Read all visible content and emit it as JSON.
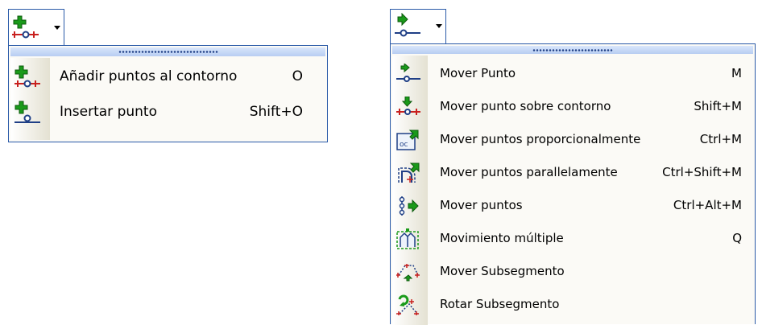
{
  "menu_left": {
    "button_icon": "add-points-icon",
    "items": [
      {
        "label": "Añadir puntos al contorno",
        "shortcut": "O",
        "icon": "add-points-contour-icon"
      },
      {
        "label": "Insertar punto",
        "shortcut": "Shift+O",
        "icon": "insert-point-icon"
      }
    ]
  },
  "menu_right": {
    "button_icon": "move-point-icon",
    "items": [
      {
        "label": "Mover Punto",
        "shortcut": "M",
        "icon": "move-point-icon"
      },
      {
        "label": "Mover punto sobre contorno",
        "shortcut": "Shift+M",
        "icon": "move-point-on-contour-icon"
      },
      {
        "label": "Mover puntos proporcionalmente",
        "shortcut": "Ctrl+M",
        "icon": "move-points-proportionally-icon"
      },
      {
        "label": "Mover puntos parallelamente",
        "shortcut": "Ctrl+Shift+M",
        "icon": "move-points-parallel-icon"
      },
      {
        "label": "Mover puntos",
        "shortcut": "Ctrl+Alt+M",
        "icon": "move-points-icon"
      },
      {
        "label": "Movimiento múltiple",
        "shortcut": "Q",
        "icon": "multiple-movement-icon"
      },
      {
        "label": "Mover Subsegmento",
        "shortcut": "",
        "icon": "move-subsegment-icon"
      },
      {
        "label": "Rotar Subsegmento",
        "shortcut": "",
        "icon": "rotate-subsegment-icon"
      }
    ]
  },
  "colors": {
    "border": "#2a5aa8",
    "grip": "#b7cdf2",
    "menu_background": "#fbfaf6",
    "icon_green": "#1a9a1a",
    "icon_red": "#c8201e",
    "icon_blue": "#1f3f86"
  }
}
